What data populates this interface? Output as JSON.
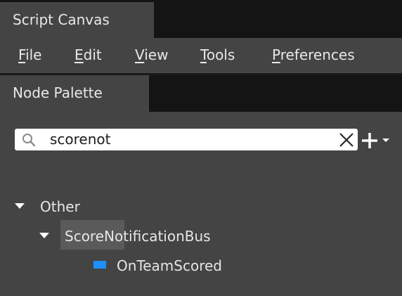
{
  "window": {
    "title": "Script Canvas"
  },
  "menu": [
    {
      "accel": "F",
      "rest": "ile"
    },
    {
      "accel": "E",
      "rest": "dit"
    },
    {
      "accel": "V",
      "rest": "iew"
    },
    {
      "accel": "T",
      "rest": "ools"
    },
    {
      "accel": "P",
      "rest": "references"
    }
  ],
  "panel": {
    "title": "Node Palette"
  },
  "search": {
    "value": "scorenot"
  },
  "tree": {
    "category": "Other",
    "bus": "ScoreNotificationBus",
    "node": "OnTeamScored"
  },
  "colors": {
    "node_icon": "#1e90ff",
    "background": "#444444"
  }
}
